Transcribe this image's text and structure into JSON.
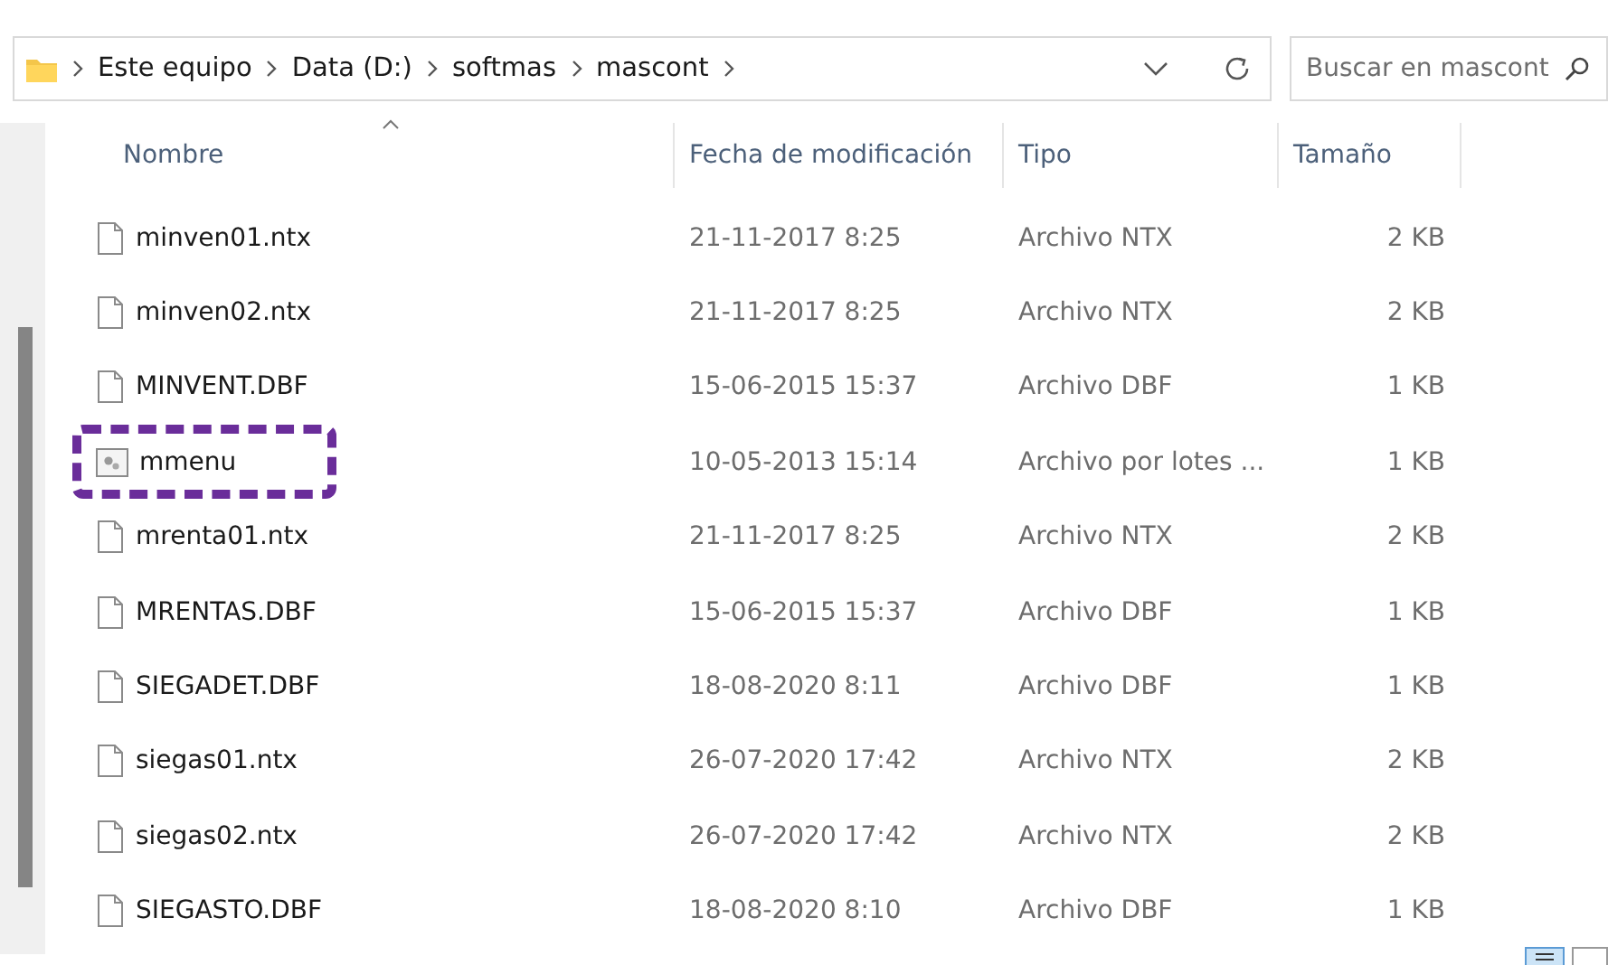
{
  "address_bar": {
    "path": [
      "Este equipo",
      "Data (D:)",
      "softmas",
      "mascont"
    ]
  },
  "search": {
    "placeholder": "Buscar en mascont"
  },
  "table": {
    "columns": [
      {
        "label": "Nombre",
        "sorted": true
      },
      {
        "label": "Fecha de modificación",
        "sorted": false
      },
      {
        "label": "Tipo",
        "sorted": false
      },
      {
        "label": "Tamaño",
        "sorted": false
      }
    ],
    "rows": [
      {
        "kind": "file",
        "name": "minven01.ntx",
        "date": "21-11-2017 8:25",
        "type": "Archivo NTX",
        "size": "2 KB",
        "highlighted": false
      },
      {
        "kind": "file",
        "name": "minven02.ntx",
        "date": "21-11-2017 8:25",
        "type": "Archivo NTX",
        "size": "2 KB",
        "highlighted": false
      },
      {
        "kind": "file",
        "name": "MINVENT.DBF",
        "date": "15-06-2015 15:37",
        "type": "Archivo DBF",
        "size": "1 KB",
        "highlighted": false
      },
      {
        "kind": "batch",
        "name": "mmenu",
        "date": "10-05-2013 15:14",
        "type": "Archivo por lotes ...",
        "size": "1 KB",
        "highlighted": true
      },
      {
        "kind": "file",
        "name": "mrenta01.ntx",
        "date": "21-11-2017 8:25",
        "type": "Archivo NTX",
        "size": "2 KB",
        "highlighted": false
      },
      {
        "kind": "file",
        "name": "MRENTAS.DBF",
        "date": "15-06-2015 15:37",
        "type": "Archivo DBF",
        "size": "1 KB",
        "highlighted": false
      },
      {
        "kind": "file",
        "name": "SIEGADET.DBF",
        "date": "18-08-2020 8:11",
        "type": "Archivo DBF",
        "size": "1 KB",
        "highlighted": false
      },
      {
        "kind": "file",
        "name": "siegas01.ntx",
        "date": "26-07-2020 17:42",
        "type": "Archivo NTX",
        "size": "2 KB",
        "highlighted": false
      },
      {
        "kind": "file",
        "name": "siegas02.ntx",
        "date": "26-07-2020 17:42",
        "type": "Archivo NTX",
        "size": "2 KB",
        "highlighted": false
      },
      {
        "kind": "file",
        "name": "SIEGASTO.DBF",
        "date": "18-08-2020 8:10",
        "type": "Archivo DBF",
        "size": "1 KB",
        "highlighted": false
      }
    ]
  }
}
